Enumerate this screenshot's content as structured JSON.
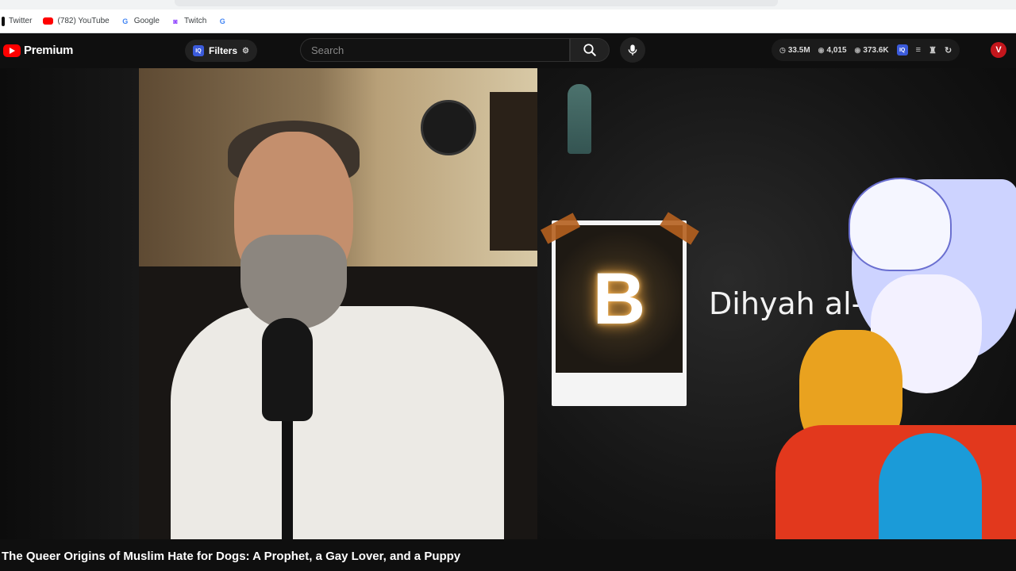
{
  "bookmarks": [
    {
      "label": "Twitter",
      "icon": "x-icon"
    },
    {
      "label": "(782) YouTube",
      "icon": "youtube-icon"
    },
    {
      "label": "Google",
      "icon": "google-icon"
    },
    {
      "label": "Twitch",
      "icon": "twitch-icon"
    },
    {
      "label": "",
      "icon": "google-icon"
    }
  ],
  "header": {
    "logo_text": "Premium",
    "filters_label": "Filters",
    "iq_badge": "IQ",
    "search_placeholder": "Search",
    "stats": {
      "views": "33.5M",
      "viewers": "4,015",
      "watching": "373.6K"
    },
    "avatar_letter": "V"
  },
  "video": {
    "overlay_letter": "B",
    "overlay_name": "Dihyah al-",
    "title": "The Queer Origins of Muslim Hate for Dogs: A Prophet, a Gay Lover, and a Puppy"
  },
  "colors": {
    "brand_red": "#ff0000",
    "background": "#0f0f0f",
    "accent_blue": "#3b5bdb"
  }
}
